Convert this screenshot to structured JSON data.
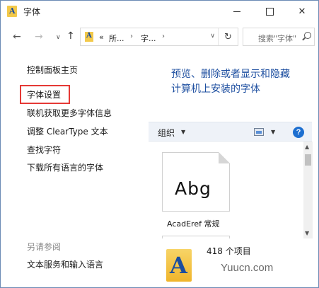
{
  "window": {
    "title": "字体"
  },
  "nav": {
    "back_glyph": "←",
    "forward_glyph": "→",
    "recent_glyph": "∨",
    "up_glyph": "↑",
    "address_prefix": "«",
    "crumb1": "所...",
    "crumb2": "字...",
    "crumb_sep": "›",
    "address_dropdown": "∨",
    "refresh_glyph": "↻",
    "search_placeholder": "搜索\"字体\""
  },
  "sidebar": {
    "home": "控制面板主页",
    "font_settings": "字体设置",
    "online_info": "联机获取更多字体信息",
    "cleartype": "调整 ClearType 文本",
    "find_char": "查找字符",
    "download_all": "下载所有语言的字体",
    "see_also": "另请参阅",
    "text_services": "文本服务和输入语言"
  },
  "content": {
    "heading": "预览、删除或者显示和隐藏计算机上安装的字体",
    "organize": "组织",
    "help": "?"
  },
  "files": [
    {
      "preview": "Abg",
      "name": "AcadEref 常规"
    }
  ],
  "details": {
    "count": "418 个项目",
    "watermark": "Yuucn.com"
  },
  "colors": {
    "heading": "#1e4fa0",
    "highlight_border": "#e53935",
    "toolbar_bg": "#eef2f8"
  }
}
